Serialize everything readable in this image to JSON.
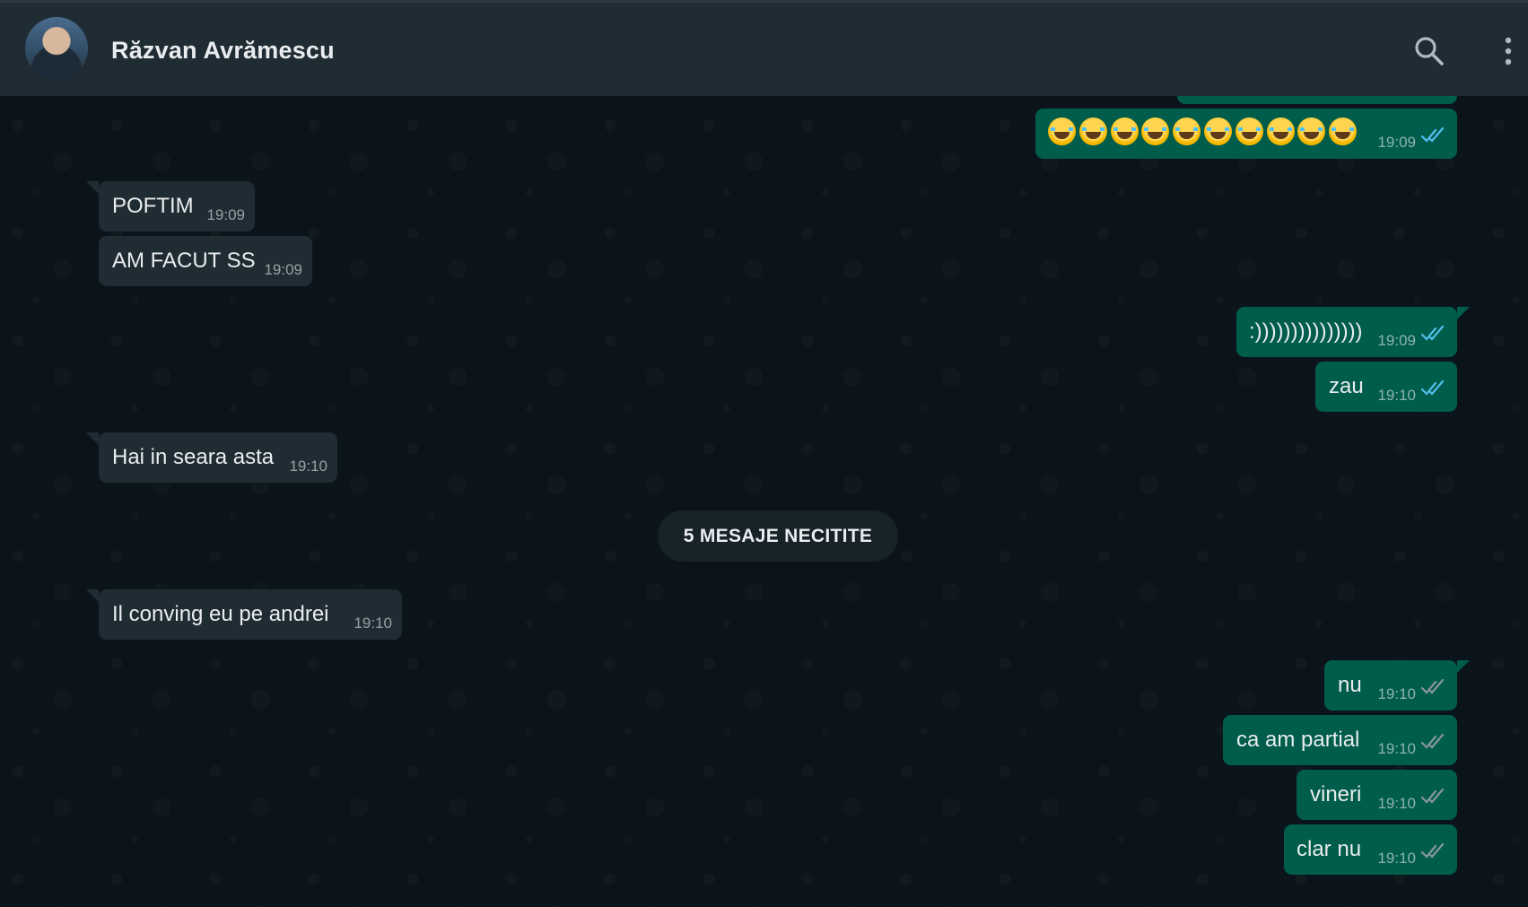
{
  "header": {
    "contact_name": "Răzvan Avrămescu"
  },
  "icons": {
    "search": "search-icon",
    "menu": "more-vertical-icon",
    "read_ticks": "double-check-icon"
  },
  "colors": {
    "header_bg": "#202c33",
    "chat_bg": "#0b141a",
    "incoming_bubble": "#202c33",
    "outgoing_bubble": "#005c4b",
    "read_tick": "#53bdeb",
    "delivered_tick": "#8696a0"
  },
  "messages": [
    {
      "direction": "out",
      "text": "😂😂😂😂😂😂😂😂😂😂",
      "time": "19:09",
      "status": "read"
    },
    {
      "direction": "in",
      "text": "POFTIM",
      "time": "19:09"
    },
    {
      "direction": "in",
      "text": "AM FACUT SS",
      "time": "19:09"
    },
    {
      "direction": "out",
      "text": ":)))))))))))))))",
      "time": "19:09",
      "status": "read"
    },
    {
      "direction": "out",
      "text": "zau",
      "time": "19:10",
      "status": "read"
    },
    {
      "direction": "in",
      "text": "Hai in seara asta",
      "time": "19:10"
    },
    {
      "direction": "in",
      "text": "Il conving eu pe andrei",
      "time": "19:10"
    },
    {
      "direction": "out",
      "text": "nu",
      "time": "19:10",
      "status": "delivered"
    },
    {
      "direction": "out",
      "text": "ca am partial",
      "time": "19:10",
      "status": "delivered"
    },
    {
      "direction": "out",
      "text": "vineri",
      "time": "19:10",
      "status": "delivered"
    },
    {
      "direction": "out",
      "text": "clar nu",
      "time": "19:10",
      "status": "delivered"
    }
  ],
  "unread_divider": "5 MESAJE NECITITE"
}
